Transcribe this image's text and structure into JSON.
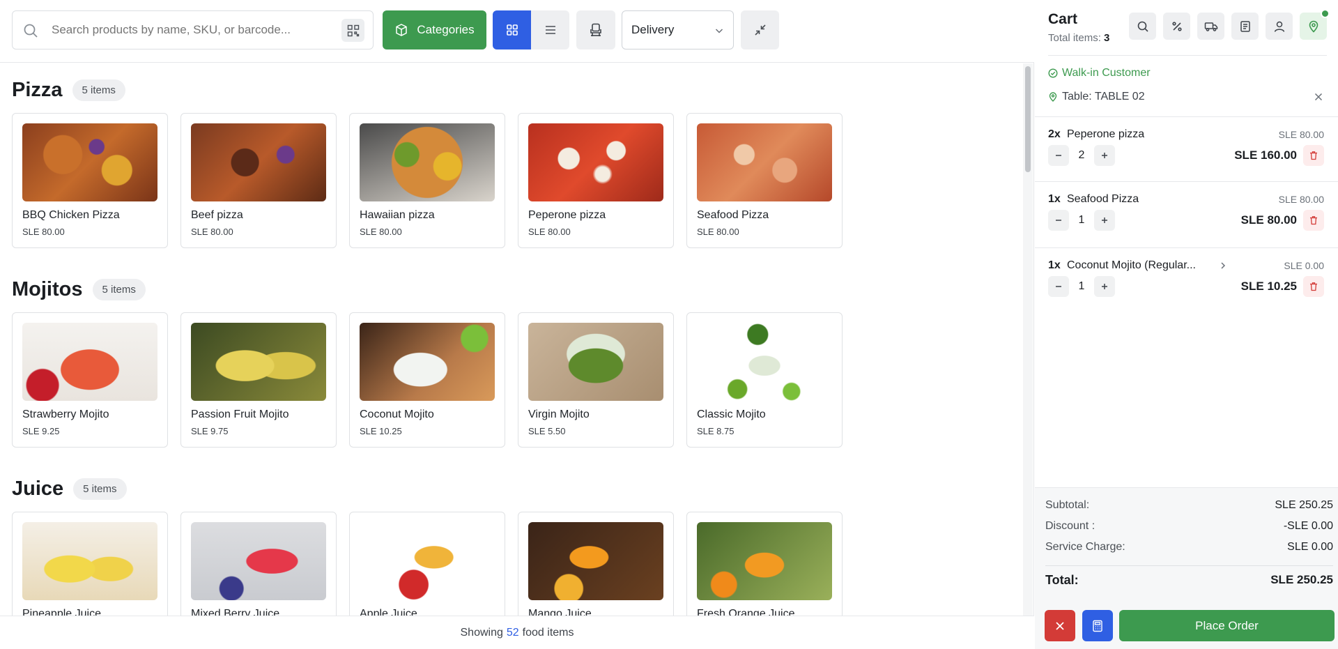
{
  "toolbar": {
    "search_placeholder": "Search products by name, SKU, or barcode...",
    "categories_label": "Categories",
    "order_type": "Delivery"
  },
  "sections": [
    {
      "title": "Pizza",
      "badge": "5 items",
      "items": [
        {
          "name": "BBQ Chicken Pizza",
          "price": "SLE 80.00"
        },
        {
          "name": "Beef pizza",
          "price": "SLE 80.00"
        },
        {
          "name": "Hawaiian pizza",
          "price": "SLE 80.00"
        },
        {
          "name": "Peperone pizza",
          "price": "SLE 80.00"
        },
        {
          "name": "Seafood Pizza",
          "price": "SLE 80.00"
        }
      ]
    },
    {
      "title": "Mojitos",
      "badge": "5 items",
      "items": [
        {
          "name": "Strawberry Mojito",
          "price": "SLE 9.25"
        },
        {
          "name": "Passion Fruit Mojito",
          "price": "SLE 9.75"
        },
        {
          "name": "Coconut Mojito",
          "price": "SLE 10.25"
        },
        {
          "name": "Virgin Mojito",
          "price": "SLE 5.50"
        },
        {
          "name": "Classic Mojito",
          "price": "SLE 8.75"
        }
      ]
    },
    {
      "title": "Juice",
      "badge": "5 items",
      "items": [
        {
          "name": "Pineapple Juice",
          "price": ""
        },
        {
          "name": "Mixed Berry Juice",
          "price": ""
        },
        {
          "name": "Apple Juice",
          "price": ""
        },
        {
          "name": "Mango Juice",
          "price": ""
        },
        {
          "name": "Fresh Orange Juice",
          "price": ""
        }
      ]
    }
  ],
  "footer": {
    "prefix": "Showing",
    "count": "52",
    "suffix": "food items"
  },
  "cart": {
    "title": "Cart",
    "total_items_label": "Total items:",
    "total_items": "3",
    "customer": "Walk-in Customer",
    "table": "Table: TABLE 02",
    "items": [
      {
        "qty_label": "2x",
        "name": "Peperone pizza",
        "unit_price": "SLE 80.00",
        "qty": "2",
        "line_total": "SLE 160.00"
      },
      {
        "qty_label": "1x",
        "name": "Seafood Pizza",
        "unit_price": "SLE 80.00",
        "qty": "1",
        "line_total": "SLE 80.00"
      },
      {
        "qty_label": "1x",
        "name": "Coconut Mojito (Regular...",
        "unit_price": "SLE 0.00",
        "qty": "1",
        "line_total": "SLE 10.25"
      }
    ],
    "summary": {
      "subtotal_label": "Subtotal:",
      "subtotal": "SLE 250.25",
      "discount_label": "Discount :",
      "discount": "-SLE 0.00",
      "service_label": "Service Charge:",
      "service": "SLE 0.00",
      "total_label": "Total:",
      "total": "SLE 250.25"
    },
    "place_order_label": "Place Order"
  },
  "colors": {
    "accent_green": "#3d9a4f",
    "accent_blue": "#2f5fe3",
    "danger_red": "#d33b37"
  },
  "icons": [
    "search-icon",
    "qr-code-icon",
    "box-icon",
    "grid-icon",
    "list-icon",
    "seat-icon",
    "chevron-down-icon",
    "collapse-icon",
    "percent-icon",
    "truck-icon",
    "receipt-icon",
    "user-icon",
    "map-pin-icon",
    "check-circle-icon",
    "close-icon",
    "minus-icon",
    "plus-icon",
    "trash-icon",
    "calculator-icon"
  ]
}
